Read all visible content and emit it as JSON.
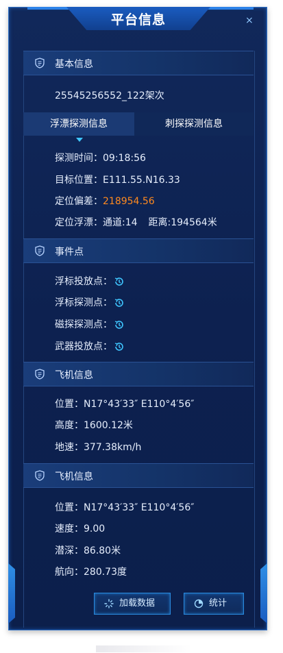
{
  "window": {
    "title": "平台信息",
    "close_label": "×"
  },
  "basic": {
    "header": "基本信息",
    "sortie": "25545256552_122架次"
  },
  "tabs": [
    {
      "label": "浮漂探测信息",
      "active": true
    },
    {
      "label": "刺探探测信息",
      "active": false
    }
  ],
  "detect": {
    "time_label": "探测时间：",
    "time_value": "09:18:56",
    "pos_label": "目标位置：",
    "pos_value": "E111.55.N16.33",
    "dev_label": "定位偏差：",
    "dev_value": "218954.56",
    "buoy_label": "定位浮漂：",
    "channel": "通道:14",
    "distance": "距离:194564米"
  },
  "events": {
    "header": "事件点",
    "items": [
      {
        "label": "浮标投放点："
      },
      {
        "label": "浮标探测点："
      },
      {
        "label": "磁探探测点："
      },
      {
        "label": "武器投放点："
      }
    ]
  },
  "aircraft1": {
    "header": "飞机信息",
    "position": "位置：N17°43′33″ E110°4′56″",
    "altitude": "高度：1600.12米",
    "ground_speed": "地速：377.38km/h"
  },
  "aircraft2": {
    "header": "飞机信息",
    "position": "位置：N17°43′33″ E110°4′56″",
    "speed": "速度：9.00",
    "depth": "潜深：86.80米",
    "heading": "航向：280.73度"
  },
  "buttons": {
    "load": "加载数据",
    "stat": "统计"
  },
  "colors": {
    "accent": "#3fc6ff",
    "warning": "#ff8a1f",
    "panel_bg": "#0d2150"
  }
}
